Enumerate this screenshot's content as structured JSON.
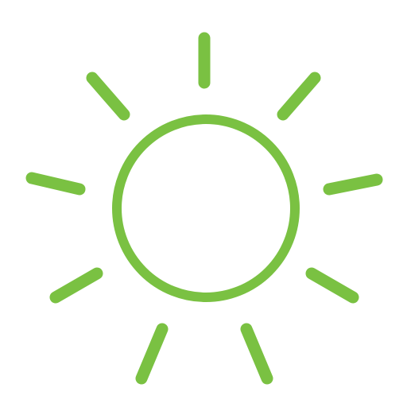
{
  "icon": {
    "name": "sun-icon",
    "color": "#7ac142",
    "background": "#ffffff"
  }
}
